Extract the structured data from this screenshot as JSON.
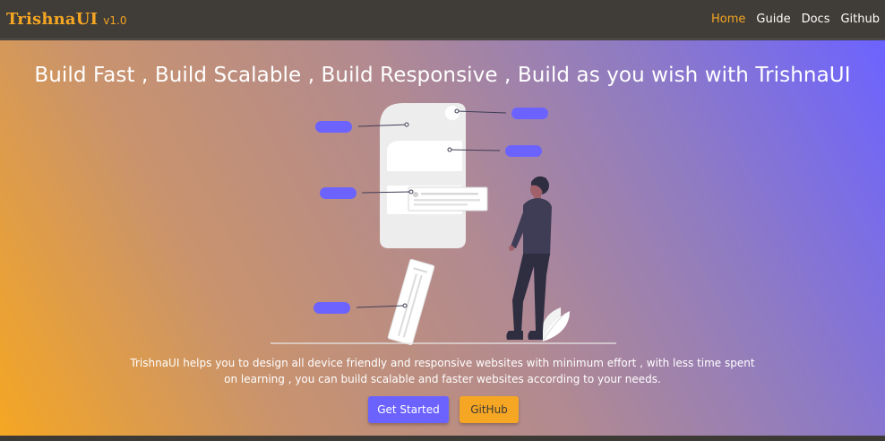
{
  "navbar": {
    "brand_name": "TrishnaUI",
    "brand_version": "v1.0",
    "links": [
      "Home",
      "Guide",
      "Docs",
      "Github"
    ],
    "active_link": "Home"
  },
  "hero": {
    "title": "Build Fast , Build Scalable , Build Responsive , Build as you wish with TrishnaUI",
    "description": "TrishnaUI helps you to design all device friendly and responsive websites with minimum effort , with less time spent on learning , you can build scalable and faster websites according to your needs.",
    "primary_button": "Get Started",
    "secondary_button": "GitHub"
  },
  "colors": {
    "accent": "#f5a623",
    "primary": "#6c63ff",
    "navbar_bg": "#403c37",
    "text_light": "#ffffff"
  }
}
